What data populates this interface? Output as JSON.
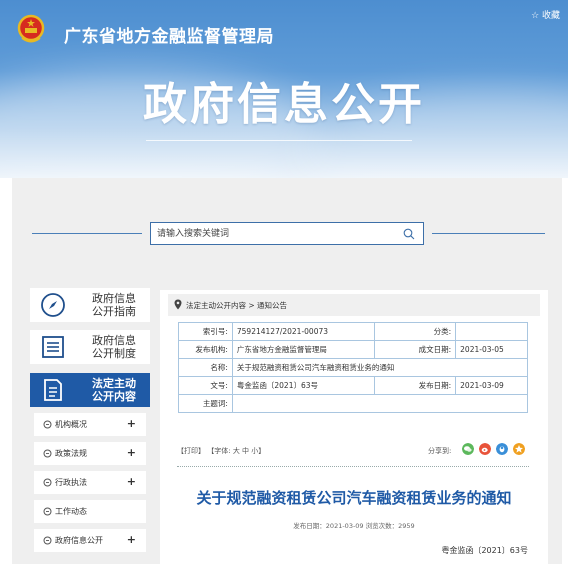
{
  "header": {
    "agency_name": "广东省地方金融监督管理局",
    "favorite_label": "☆ 收藏",
    "banner_title": "政府信息公开"
  },
  "search": {
    "placeholder": "请输入搜索关键词"
  },
  "sidebar": {
    "cards": [
      {
        "line1": "政府信息",
        "line2": "公开指南"
      },
      {
        "line1": "政府信息",
        "line2": "公开制度"
      },
      {
        "line1": "法定主动",
        "line2": "公开内容"
      }
    ],
    "sub_items": [
      {
        "label": "机构概况",
        "expand": "+"
      },
      {
        "label": "政策法规",
        "expand": "+"
      },
      {
        "label": "行政执法",
        "expand": "+"
      },
      {
        "label": "工作动态",
        "expand": ""
      },
      {
        "label": "政府信息公开",
        "expand": "+"
      }
    ]
  },
  "breadcrumb": "法定主动公开内容  >  通知公告",
  "meta": {
    "index_label": "索引号:",
    "index_value": "759214127/2021-00073",
    "category_label": "分类:",
    "category_value": "",
    "publisher_label": "发布机构:",
    "publisher_value": "广东省地方金融监督管理局",
    "created_label": "成文日期:",
    "created_value": "2021-03-05",
    "name_label": "名称:",
    "name_value": "关于规范融资租赁公司汽车融资租赁业务的通知",
    "docno_label": "文号:",
    "docno_value": "粤金监函〔2021〕63号",
    "published_label": "发布日期:",
    "published_value": "2021-03-09",
    "subject_label": "主题词:",
    "subject_value": ""
  },
  "tools": {
    "print": "【打印】",
    "font": "【字体: 大 中 小】",
    "share_label": "分享到:"
  },
  "share_colors": [
    "#5cb85c",
    "#e8533a",
    "#3a8fd8",
    "#f0a020"
  ],
  "article": {
    "title": "关于规范融资租赁公司汽车融资租赁业务的通知",
    "info": "发布日期：2021-03-09  浏览次数：2959",
    "doc_number": "粤金监函〔2021〕63号"
  },
  "colors": {
    "accent": "#1f5aa6",
    "banner": "#5f9cd8"
  }
}
